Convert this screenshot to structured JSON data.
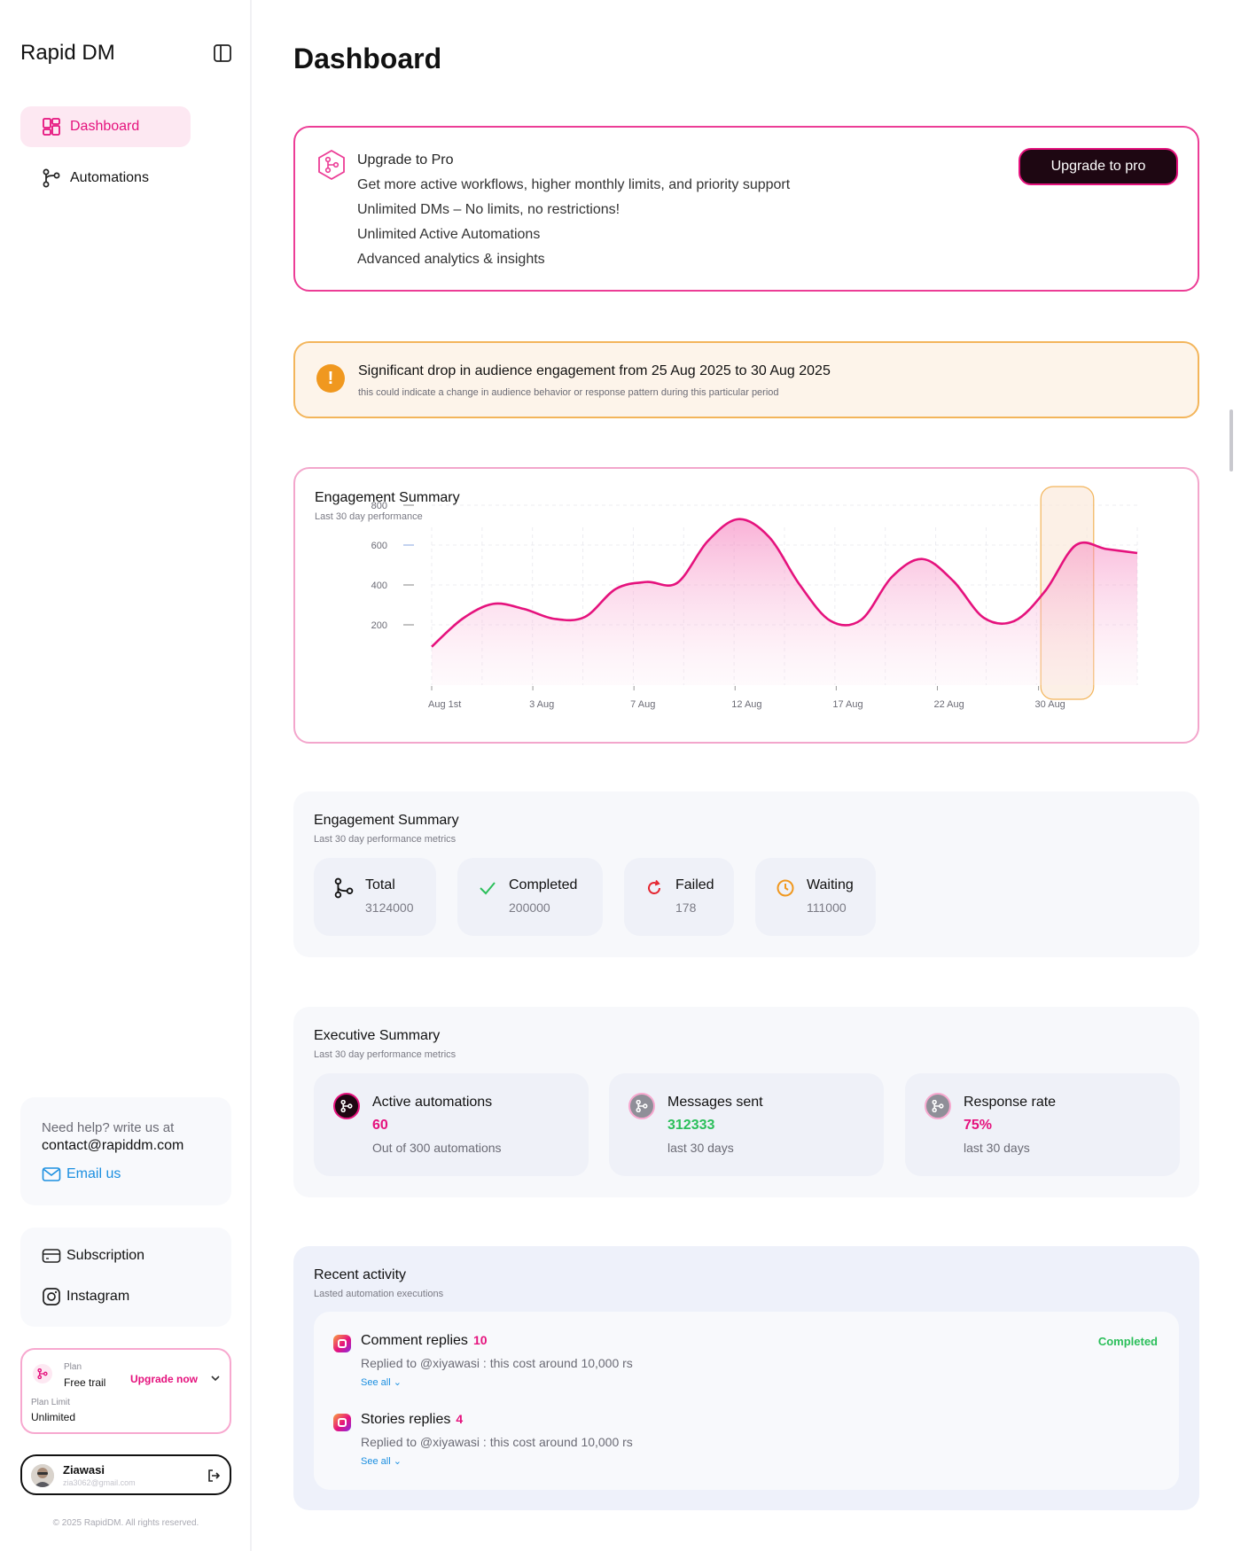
{
  "app": {
    "brand": "Rapid DM"
  },
  "nav": [
    {
      "label": "Dashboard",
      "active": true,
      "icon": "grid-icon"
    },
    {
      "label": "Automations",
      "active": false,
      "icon": "workflow-icon"
    }
  ],
  "help": {
    "line1": "Need help? write us at",
    "email": "contact@rapiddm.com",
    "link": "Email us"
  },
  "sidebar_links": [
    {
      "label": "Subscription",
      "icon": "card-icon"
    },
    {
      "label": "Instagram",
      "icon": "instagram-icon"
    }
  ],
  "plan": {
    "plan_label": "Plan",
    "plan_value": "Free trail",
    "upgrade": "Upgrade now",
    "limit_label": "Plan Limit",
    "limit_value": "Unlimited"
  },
  "user": {
    "name": "Ziawasi",
    "email": "zia3062@gmail.com"
  },
  "footer": {
    "copyright": "© 2025 RapidDM. All rights reserved."
  },
  "page": {
    "title": "Dashboard"
  },
  "pro": {
    "heading": "Upgrade to Pro",
    "description": "Get more active workflows, higher monthly limits, and priority support",
    "features": [
      "Unlimited DMs – No limits, no restrictions!",
      "Unlimited Active Automations",
      "Advanced analytics & insights"
    ],
    "button": "Upgrade to pro"
  },
  "alert": {
    "title": "Significant drop in audience engagement from 25 Aug 2025 to 30 Aug 2025",
    "subtitle": "this could indicate a change in audience behavior or response pattern during this particular  period",
    "icon": "!"
  },
  "chart_data": {
    "type": "area",
    "title": "Engagement Summary",
    "subtitle": "Last 30 day performance",
    "x_ticks": [
      "Aug 1st",
      "3 Aug",
      "7 Aug",
      "12 Aug",
      "17 Aug",
      "22 Aug",
      "30 Aug"
    ],
    "y_ticks": [
      800,
      600,
      400,
      200
    ],
    "ylim": [
      0,
      800
    ],
    "series": [
      {
        "values": [
          90,
          230,
          305,
          280,
          230,
          240,
          380,
          415,
          410,
          620,
          730,
          640,
          400,
          220,
          225,
          440,
          530,
          420,
          235,
          220,
          370,
          600,
          580,
          560
        ]
      }
    ],
    "highlight": {
      "range_index": [
        20,
        21
      ],
      "color": "#f3b55b"
    },
    "line_color": "#e5127d",
    "grid": true
  },
  "engagement": {
    "title": "Engagement Summary",
    "subtitle": "Last 30 day performance metrics",
    "stats": [
      {
        "label": "Total",
        "value": "3124000",
        "icon": "workflow-icon"
      },
      {
        "label": "Completed",
        "value": "200000",
        "icon": "check-icon"
      },
      {
        "label": "Failed",
        "value": "178",
        "icon": "retry-icon"
      },
      {
        "label": "Waiting",
        "value": "111000",
        "icon": "clock-icon"
      }
    ]
  },
  "executive": {
    "title": "Executive Summary",
    "subtitle": "Last 30 day performance metrics",
    "items": [
      {
        "label": "Active automations",
        "value": "60",
        "desc": "Out of 300 automations",
        "value_color": "#e5127d"
      },
      {
        "label": "Messages sent",
        "value": "312333",
        "desc": "last 30 days",
        "value_color": "#2bbf5a"
      },
      {
        "label": "Response rate",
        "value": "75%",
        "desc": "last 30 days",
        "value_color": "#e5127d"
      }
    ]
  },
  "activity": {
    "title": "Recent activity",
    "subtitle": "Lasted automation executions",
    "items": [
      {
        "name": "Comment replies",
        "count": "10",
        "desc": "Replied to @xiyawasi : this cost around 10,000 rs",
        "see_all": "See all ⌄",
        "status": "Completed"
      },
      {
        "name": "Stories replies",
        "count": "4",
        "desc": "Replied to @xiyawasi : this cost around 10,000 rs",
        "see_all": "See all ⌄",
        "status": ""
      }
    ]
  }
}
